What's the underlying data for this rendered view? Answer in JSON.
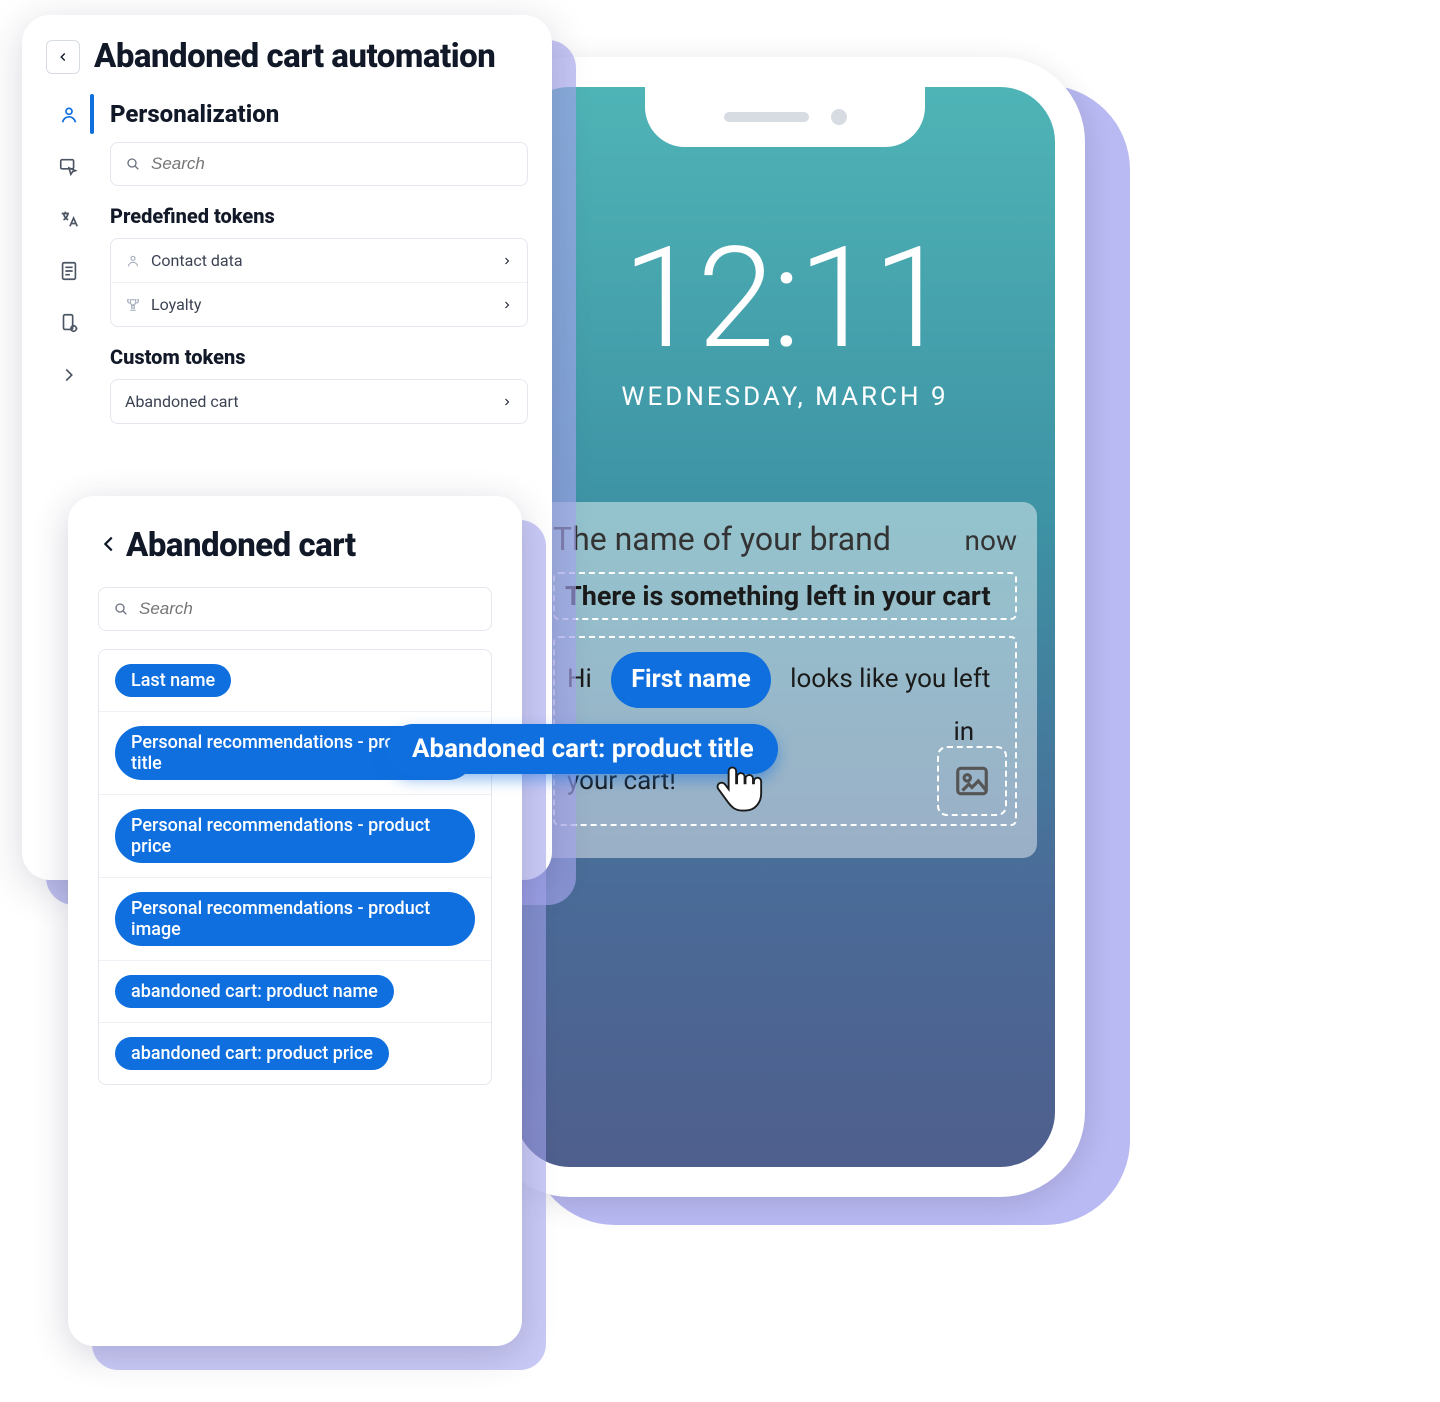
{
  "panel": {
    "title": "Abandoned cart automation",
    "section": "Personalization",
    "search_placeholder": "Search",
    "predefined_heading": "Predefined tokens",
    "predefined": [
      {
        "label": "Contact data"
      },
      {
        "label": "Loyalty"
      }
    ],
    "custom_heading": "Custom tokens",
    "custom": [
      {
        "label": "Abandoned cart"
      }
    ]
  },
  "subpanel": {
    "title": "Abandoned cart",
    "search_placeholder": "Search",
    "tags": [
      "Last name",
      "Personal recommendations - product title",
      "Personal recommendations - product price",
      "Personal recommendations - product image",
      "abandoned cart: product name",
      "abandoned cart: product price"
    ]
  },
  "drag_token": "Abandoned cart: product title",
  "phone": {
    "time": "12:11",
    "date": "WEDNESDAY, MARCH 9",
    "brand": "The name of your brand",
    "when": "now",
    "title": "There is something left in your cart",
    "body_hi": "Hi",
    "body_token": "First name",
    "body_mid": "looks like you left",
    "body_end": "in your cart!"
  }
}
